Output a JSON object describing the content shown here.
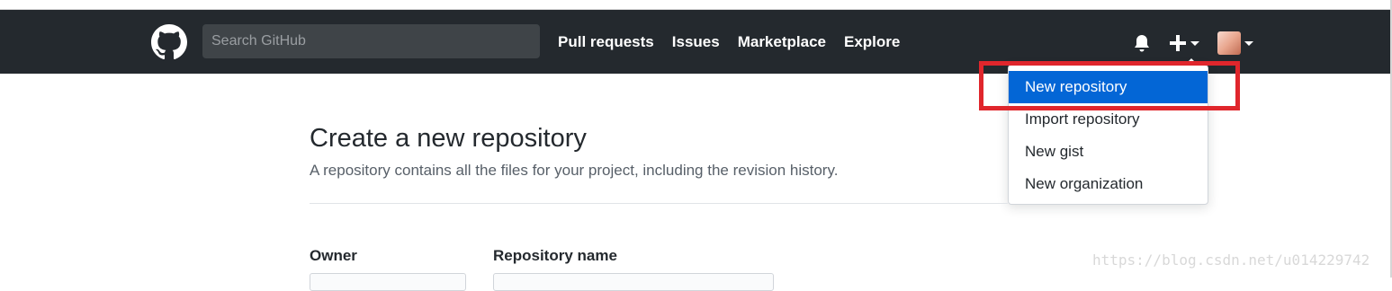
{
  "header": {
    "search_placeholder": "Search GitHub",
    "nav": [
      "Pull requests",
      "Issues",
      "Marketplace",
      "Explore"
    ],
    "icons": {
      "logo": "github-octocat-icon",
      "notifications": "bell-icon",
      "create": "plus-icon",
      "avatar": "user-avatar"
    }
  },
  "dropdown": {
    "items": [
      "New repository",
      "Import repository",
      "New gist",
      "New organization"
    ],
    "active_index": 0
  },
  "main": {
    "title": "Create a new repository",
    "subtitle": "A repository contains all the files for your project, including the revision history.",
    "owner_label": "Owner",
    "repo_name_label": "Repository name"
  },
  "watermark": "https://blog.csdn.net/u014229742",
  "colors": {
    "header_bg": "#24292e",
    "active_item": "#0366d6",
    "highlight_border": "#e0262c"
  }
}
